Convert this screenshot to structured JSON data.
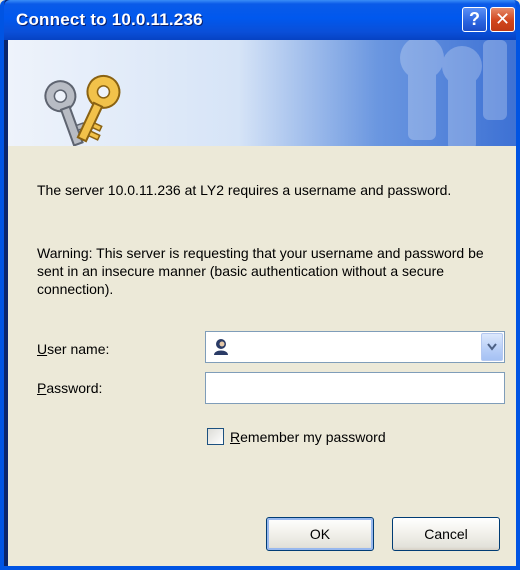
{
  "window": {
    "title": "Connect to 10.0.11.236",
    "help_label": "?",
    "close_label": "✕"
  },
  "banner": {
    "icon": "keys-icon"
  },
  "message": {
    "prompt": "The server 10.0.11.236 at LY2 requires a username and password.",
    "warning": "Warning: This server is requesting that your username and password be sent in an insecure manner (basic authentication without a secure connection)."
  },
  "form": {
    "username_label_mnemonic": "U",
    "username_label_rest": "ser name:",
    "username_value": "",
    "username_icon": "user-avatar-icon",
    "password_label_mnemonic": "P",
    "password_label_rest": "assword:",
    "password_value": "",
    "remember_label_mnemonic": "R",
    "remember_label_rest": "emember my password",
    "remember_checked": false
  },
  "buttons": {
    "ok_label": "OK",
    "cancel_label": "Cancel"
  },
  "colors": {
    "titlebar": "#0058EE",
    "dialog_bg": "#ECE9D8",
    "close_btn": "#D1451C"
  }
}
